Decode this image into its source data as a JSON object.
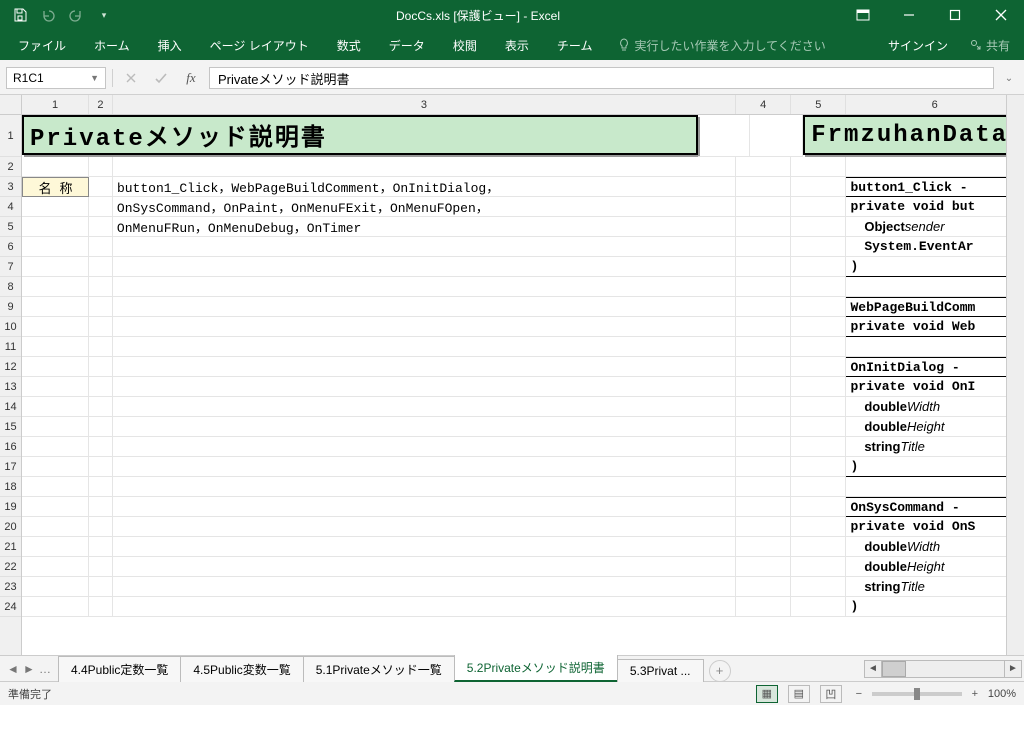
{
  "titlebar": {
    "title": "DocCs.xls  [保護ビュー] - Excel"
  },
  "ribbon": {
    "file": "ファイル",
    "home": "ホーム",
    "insert": "挿入",
    "pagelayout": "ページ レイアウト",
    "formulas": "数式",
    "data": "データ",
    "review": "校閲",
    "view": "表示",
    "team": "チーム",
    "tellme": "実行したい作業を入力してください",
    "signin": "サインイン",
    "share": "共有"
  },
  "namebox": "R1C1",
  "formula": "Privateメソッド説明書",
  "colhdrs": {
    "1": "1",
    "2": "2",
    "3": "3",
    "4": "4",
    "5": "5",
    "6": "6"
  },
  "cells": {
    "title_main": "Privateメソッド説明書",
    "title_right": "FrmzuhanData.c",
    "label_name": "名 称",
    "r3c3": "button1_Click，WebPageBuildComment，OnInitDialog，",
    "r4c3": "OnSysCommand，OnPaint，OnMenuFExit，OnMenuFOpen，",
    "r5c3": "OnMenuFRun，OnMenuDebug，OnTimer",
    "r3c6": "button1_Click -",
    "r4c6_a": "private void but",
    "r4c6_obj": "Object ",
    "r4c6_sender": "sender",
    "r5c6_a": "System.EventAr",
    "r6c6": ")",
    "r8c6": "WebPageBuildComm",
    "r9c6": "private void Web",
    "r11c6": "OnInitDialog - ",
    "r12c6": "private void OnI",
    "r13c6_a": "double ",
    "r13c6_b": "Width",
    "r14c6_a": "double ",
    "r14c6_b": "Height",
    "r15c6_a": "string ",
    "r15c6_b": "Title",
    "r16c6": ")",
    "r18c6": "OnSysCommand - ",
    "r19c6": "private void OnS",
    "r20c6_a": "double ",
    "r20c6_b": "Width",
    "r21c6_a": "double ",
    "r21c6_b": "Height",
    "r22c6_a": "string ",
    "r22c6_b": "Title",
    "r23c6": ")"
  },
  "sheets": {
    "s1": "4.4Public定数一覧",
    "s2": "4.5Public変数一覧",
    "s3": "5.1Privateメソッド一覧",
    "s4": "5.2Privateメソッド説明書",
    "s5": "5.3Privat ..."
  },
  "status": {
    "ready": "準備完了",
    "zoom": "100%"
  }
}
